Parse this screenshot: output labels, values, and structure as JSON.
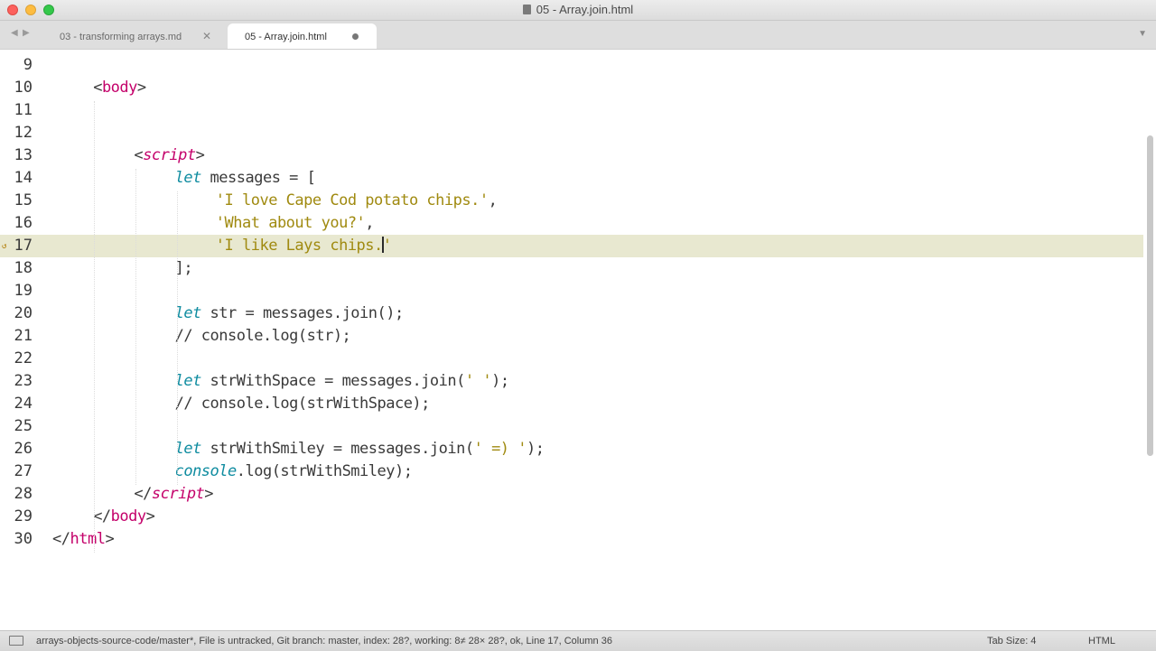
{
  "window": {
    "title": "05 - Array.join.html"
  },
  "tabs": [
    {
      "label": "03 - transforming arrays.md",
      "close_glyph": "✕"
    },
    {
      "label": "05 - Array.join.html"
    }
  ],
  "editor": {
    "active_line": 17,
    "lines": [
      {
        "n": "9",
        "indent": 0,
        "tokens": []
      },
      {
        "n": "10",
        "indent": 2,
        "tokens": [
          {
            "t": "<",
            "c": "tg"
          },
          {
            "t": "body",
            "c": "tn"
          },
          {
            "t": ">",
            "c": "tg"
          }
        ]
      },
      {
        "n": "11",
        "indent": 0,
        "tokens": []
      },
      {
        "n": "12",
        "indent": 0,
        "tokens": []
      },
      {
        "n": "13",
        "indent": 4,
        "tokens": [
          {
            "t": "<",
            "c": "tg"
          },
          {
            "t": "script",
            "c": "tn ki-tag"
          },
          {
            "t": ">",
            "c": "tg"
          }
        ]
      },
      {
        "n": "14",
        "indent": 6,
        "tokens": [
          {
            "t": "let",
            "c": "ki"
          },
          {
            "t": " messages = [",
            "c": "tg"
          }
        ]
      },
      {
        "n": "15",
        "indent": 8,
        "tokens": [
          {
            "t": "'I love Cape Cod potato chips.'",
            "c": "st"
          },
          {
            "t": ",",
            "c": "tg"
          }
        ]
      },
      {
        "n": "16",
        "indent": 8,
        "tokens": [
          {
            "t": "'What about you?'",
            "c": "st"
          },
          {
            "t": ",",
            "c": "tg"
          }
        ]
      },
      {
        "n": "17",
        "indent": 8,
        "tokens": [
          {
            "t": "'I like Lays chips.",
            "c": "st"
          },
          {
            "t": "|",
            "c": "cursor"
          },
          {
            "t": "'",
            "c": "st"
          }
        ]
      },
      {
        "n": "18",
        "indent": 6,
        "tokens": [
          {
            "t": "];",
            "c": "tg"
          }
        ]
      },
      {
        "n": "19",
        "indent": 0,
        "tokens": []
      },
      {
        "n": "20",
        "indent": 6,
        "tokens": [
          {
            "t": "let",
            "c": "ki"
          },
          {
            "t": " str = messages.join();",
            "c": "tg"
          }
        ]
      },
      {
        "n": "21",
        "indent": 6,
        "tokens": [
          {
            "t": "// console.log(str);",
            "c": "cm"
          }
        ]
      },
      {
        "n": "22",
        "indent": 0,
        "tokens": []
      },
      {
        "n": "23",
        "indent": 6,
        "tokens": [
          {
            "t": "let",
            "c": "ki"
          },
          {
            "t": " strWithSpace = messages.join(",
            "c": "tg"
          },
          {
            "t": "' '",
            "c": "st"
          },
          {
            "t": ");",
            "c": "tg"
          }
        ]
      },
      {
        "n": "24",
        "indent": 6,
        "tokens": [
          {
            "t": "// console.log(strWithSpace);",
            "c": "cm"
          }
        ]
      },
      {
        "n": "25",
        "indent": 0,
        "tokens": []
      },
      {
        "n": "26",
        "indent": 6,
        "tokens": [
          {
            "t": "let",
            "c": "ki"
          },
          {
            "t": " strWithSmiley = messages.join(",
            "c": "tg"
          },
          {
            "t": "' =) '",
            "c": "st"
          },
          {
            "t": ");",
            "c": "tg"
          }
        ]
      },
      {
        "n": "27",
        "indent": 6,
        "tokens": [
          {
            "t": "console",
            "c": "fi"
          },
          {
            "t": ".log(strWithSmiley);",
            "c": "tg"
          }
        ]
      },
      {
        "n": "28",
        "indent": 4,
        "tokens": [
          {
            "t": "</",
            "c": "tg"
          },
          {
            "t": "script",
            "c": "tn ki-tag"
          },
          {
            "t": ">",
            "c": "tg"
          }
        ]
      },
      {
        "n": "29",
        "indent": 2,
        "tokens": [
          {
            "t": "</",
            "c": "tg"
          },
          {
            "t": "body",
            "c": "tn"
          },
          {
            "t": ">",
            "c": "tg"
          }
        ]
      },
      {
        "n": "30",
        "indent": 0,
        "tokens": [
          {
            "t": "</",
            "c": "tg"
          },
          {
            "t": "html",
            "c": "tn"
          },
          {
            "t": ">",
            "c": "tg"
          }
        ]
      }
    ]
  },
  "statusbar": {
    "info": "arrays-objects-source-code/master*, File is untracked, Git branch: master, index: 28?, working: 8≠ 28× 28?, ok, Line 17, Column 36",
    "tab_size": "Tab Size: 4",
    "syntax": "HTML"
  },
  "colors": {
    "tag_name": "#c4006a",
    "keyword": "#0f8ca0",
    "string": "#a08a10",
    "active_line_bg": "#e8e8d0"
  },
  "icons": {
    "close": "close-icon",
    "modified": "unsaved-dot-icon",
    "back": "back-arrow-icon",
    "forward": "forward-arrow-icon",
    "tab_menu": "chevron-down-icon",
    "panel": "panel-toggle-icon",
    "line_marker": "git-modified-marker-icon"
  }
}
